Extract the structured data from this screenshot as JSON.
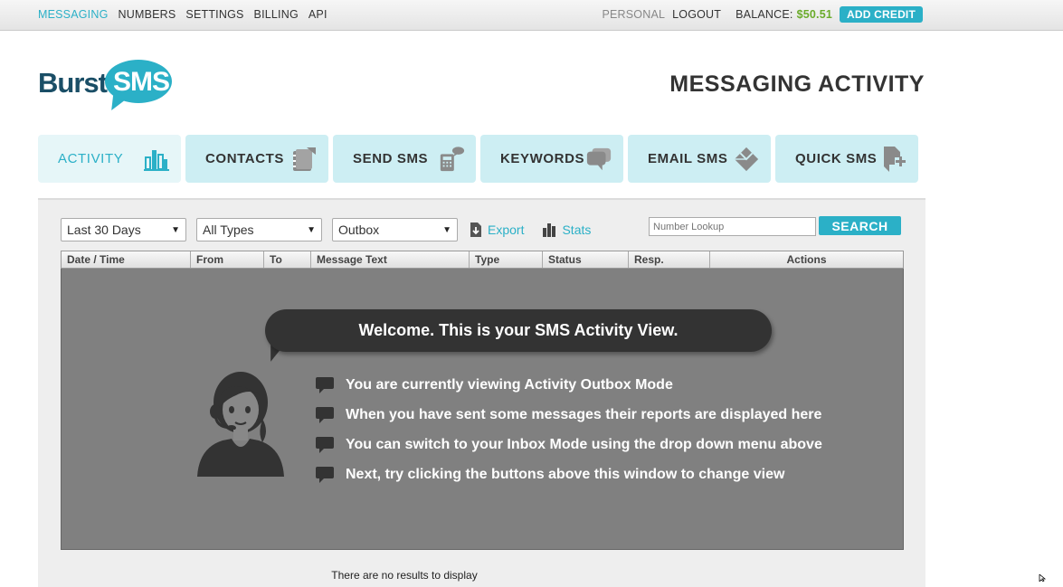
{
  "topnav": {
    "items": [
      {
        "label": "MESSAGING",
        "active": true
      },
      {
        "label": "NUMBERS"
      },
      {
        "label": "SETTINGS"
      },
      {
        "label": "BILLING"
      },
      {
        "label": "API"
      }
    ],
    "personal": "PERSONAL",
    "logout": "LOGOUT",
    "balance_label": "BALANCE:",
    "balance_value": "$50.51",
    "add_credit": "ADD CREDIT"
  },
  "logo": {
    "part1": "Burst",
    "part2": "SMS"
  },
  "page_title": "MESSAGING ACTIVITY",
  "tabs": [
    {
      "label": "ACTIVITY",
      "icon": "bar-chart-icon",
      "active": true
    },
    {
      "label": "CONTACTS",
      "icon": "contacts-book-icon"
    },
    {
      "label": "SEND SMS",
      "icon": "phone-message-icon"
    },
    {
      "label": "KEYWORDS",
      "icon": "speech-bubble-icon"
    },
    {
      "label": "EMAIL SMS",
      "icon": "envelope-icon"
    },
    {
      "label": "QUICK SMS",
      "icon": "quick-add-icon"
    }
  ],
  "filters": {
    "period": "Last 30 Days",
    "type": "All Types",
    "mode": "Outbox",
    "export": "Export",
    "stats": "Stats",
    "lookup_placeholder": "Number Lookup",
    "search": "SEARCH"
  },
  "table": {
    "columns": [
      "Date / Time",
      "From",
      "To",
      "Message Text",
      "Type",
      "Status",
      "Resp.",
      "Actions"
    ]
  },
  "welcome": {
    "title": "Welcome. This is your SMS Activity View.",
    "bullets": [
      "You are currently viewing Activity Outbox Mode",
      "When you have sent some messages their reports are displayed here",
      "You can switch to your Inbox Mode using the drop down menu above",
      "Next, try clicking the buttons above this window to change view"
    ]
  },
  "no_results": "There are no results to display",
  "colors": {
    "accent": "#2bb0c7",
    "brand_dark": "#1a4e66",
    "balance": "#6aab2a",
    "tab_bg": "#cdeef3"
  }
}
